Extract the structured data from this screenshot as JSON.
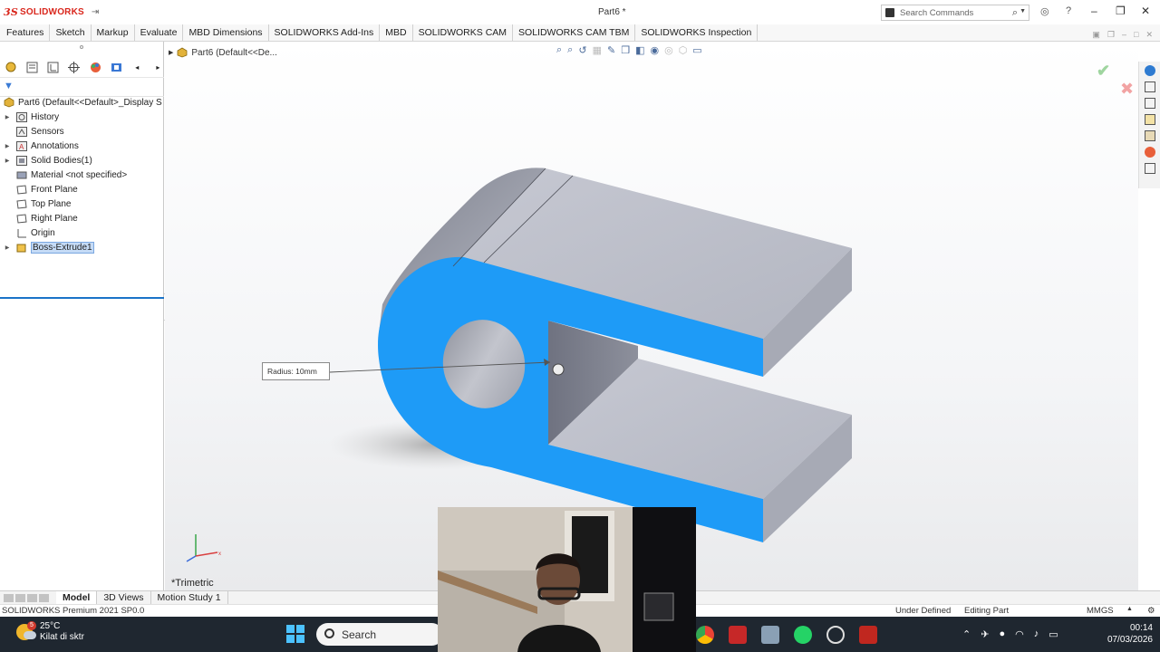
{
  "app": {
    "brand": "SOLIDWORKS",
    "brand_symbol": "3S",
    "document_title": "Part6 *"
  },
  "search_commands": {
    "placeholder": "Search Commands"
  },
  "command_tabs": [
    "Features",
    "Sketch",
    "Markup",
    "Evaluate",
    "MBD Dimensions",
    "SOLIDWORKS Add-Ins",
    "MBD",
    "SOLIDWORKS CAM",
    "SOLIDWORKS CAM TBM",
    "SOLIDWORKS Inspection"
  ],
  "feature_tree": {
    "root": "Part6  (Default<<Default>_Display S",
    "items": [
      {
        "label": "History",
        "expandable": true,
        "icon": "history-icon"
      },
      {
        "label": "Sensors",
        "expandable": false,
        "icon": "sensors-icon"
      },
      {
        "label": "Annotations",
        "expandable": true,
        "icon": "annotations-icon"
      },
      {
        "label": "Solid Bodies(1)",
        "expandable": true,
        "icon": "solid-bodies-icon"
      },
      {
        "label": "Material <not specified>",
        "expandable": false,
        "icon": "material-icon"
      },
      {
        "label": "Front Plane",
        "expandable": false,
        "icon": "plane-icon"
      },
      {
        "label": "Top Plane",
        "expandable": false,
        "icon": "plane-icon"
      },
      {
        "label": "Right Plane",
        "expandable": false,
        "icon": "plane-icon"
      },
      {
        "label": "Origin",
        "expandable": false,
        "icon": "origin-icon"
      },
      {
        "label": "Boss-Extrude1",
        "expandable": true,
        "icon": "extrude-icon",
        "selected": true
      }
    ]
  },
  "viewport": {
    "breadcrumb": "Part6  (Default<<De...",
    "view_orientation": "*Trimetric",
    "dimension_label": "Radius: 10mm"
  },
  "bottom_tabs": [
    "Model",
    "3D Views",
    "Motion Study 1"
  ],
  "status": {
    "product": "SOLIDWORKS Premium 2021 SP0.0",
    "definition": "Under Defined",
    "mode": "Editing Part",
    "units": "MMGS"
  },
  "taskbar": {
    "weather_temp": "25°C",
    "weather_desc": "Kilat di sktr",
    "weather_badge": "5",
    "search_label": "Search",
    "time": "00:14",
    "date": "07/03/2026"
  },
  "colors": {
    "selection_face": "#1e9bf7",
    "model_gray": "#b7bac4",
    "accent_red": "#d9261c"
  }
}
